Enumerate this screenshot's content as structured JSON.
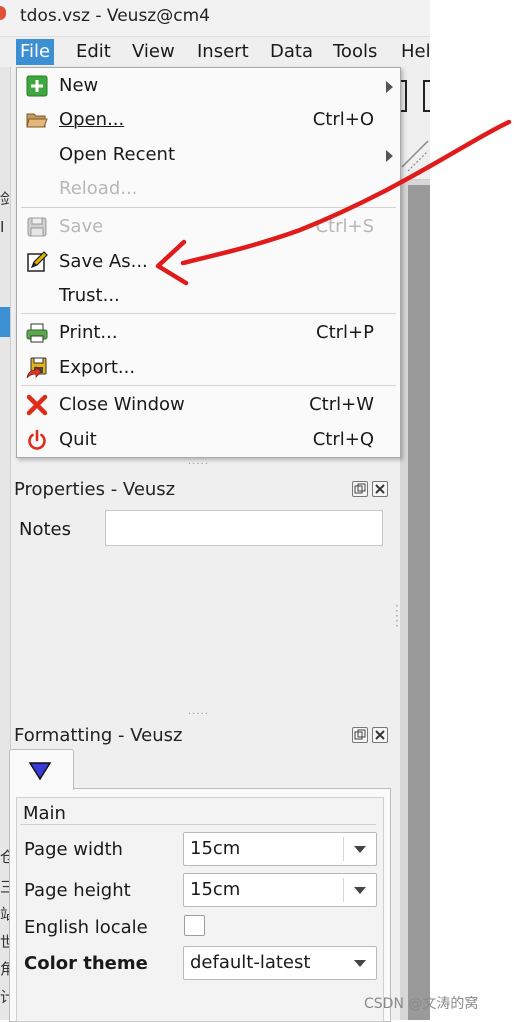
{
  "window": {
    "title": "tdos.vsz - Veusz@cm4"
  },
  "menubar": {
    "items": [
      {
        "label": "File"
      },
      {
        "label": "Edit"
      },
      {
        "label": "View"
      },
      {
        "label": "Insert"
      },
      {
        "label": "Data"
      },
      {
        "label": "Tools"
      },
      {
        "label": "Hel"
      }
    ]
  },
  "left_strip_glyphs": [
    "剑",
    "I",
    "仓",
    "三",
    "站",
    "世",
    "角",
    "计"
  ],
  "file_menu": {
    "new": {
      "label": "New",
      "icon": "new-plus-icon",
      "has_submenu": true
    },
    "open": {
      "label": "Open...",
      "shortcut": "Ctrl+O",
      "icon": "folder-open-icon"
    },
    "open_recent": {
      "label": "Open Recent",
      "has_submenu": true
    },
    "reload": {
      "label": "Reload...",
      "enabled": false
    },
    "save": {
      "label": "Save",
      "shortcut": "Ctrl+S",
      "enabled": false,
      "icon": "floppy-disk-icon"
    },
    "save_as": {
      "label": "Save As...",
      "icon": "save-as-pencil-icon"
    },
    "trust": {
      "label": "Trust..."
    },
    "print": {
      "label": "Print...",
      "shortcut": "Ctrl+P",
      "icon": "printer-icon"
    },
    "export": {
      "label": "Export...",
      "icon": "export-icon"
    },
    "close_window": {
      "label": "Close Window",
      "shortcut": "Ctrl+W",
      "icon": "close-x-icon"
    },
    "quit": {
      "label": "Quit",
      "shortcut": "Ctrl+Q",
      "icon": "power-icon"
    }
  },
  "properties_panel": {
    "title": "Properties - Veusz",
    "notes_label": "Notes",
    "notes_value": ""
  },
  "formatting_panel": {
    "title": "Formatting - Veusz",
    "tab_icon": "triangle-down-icon",
    "group_title": "Main",
    "page_width_label": "Page width",
    "page_width_value": "15cm",
    "page_height_label": "Page height",
    "page_height_value": "15cm",
    "english_locale_label": "English locale",
    "english_locale_checked": false,
    "color_theme_label": "Color theme",
    "color_theme_value": "default-latest"
  },
  "watermark": "CSDN @文涛的窝",
  "colors": {
    "menu_highlight": "#3c8fd3",
    "annotation_red": "#e01b1b"
  }
}
